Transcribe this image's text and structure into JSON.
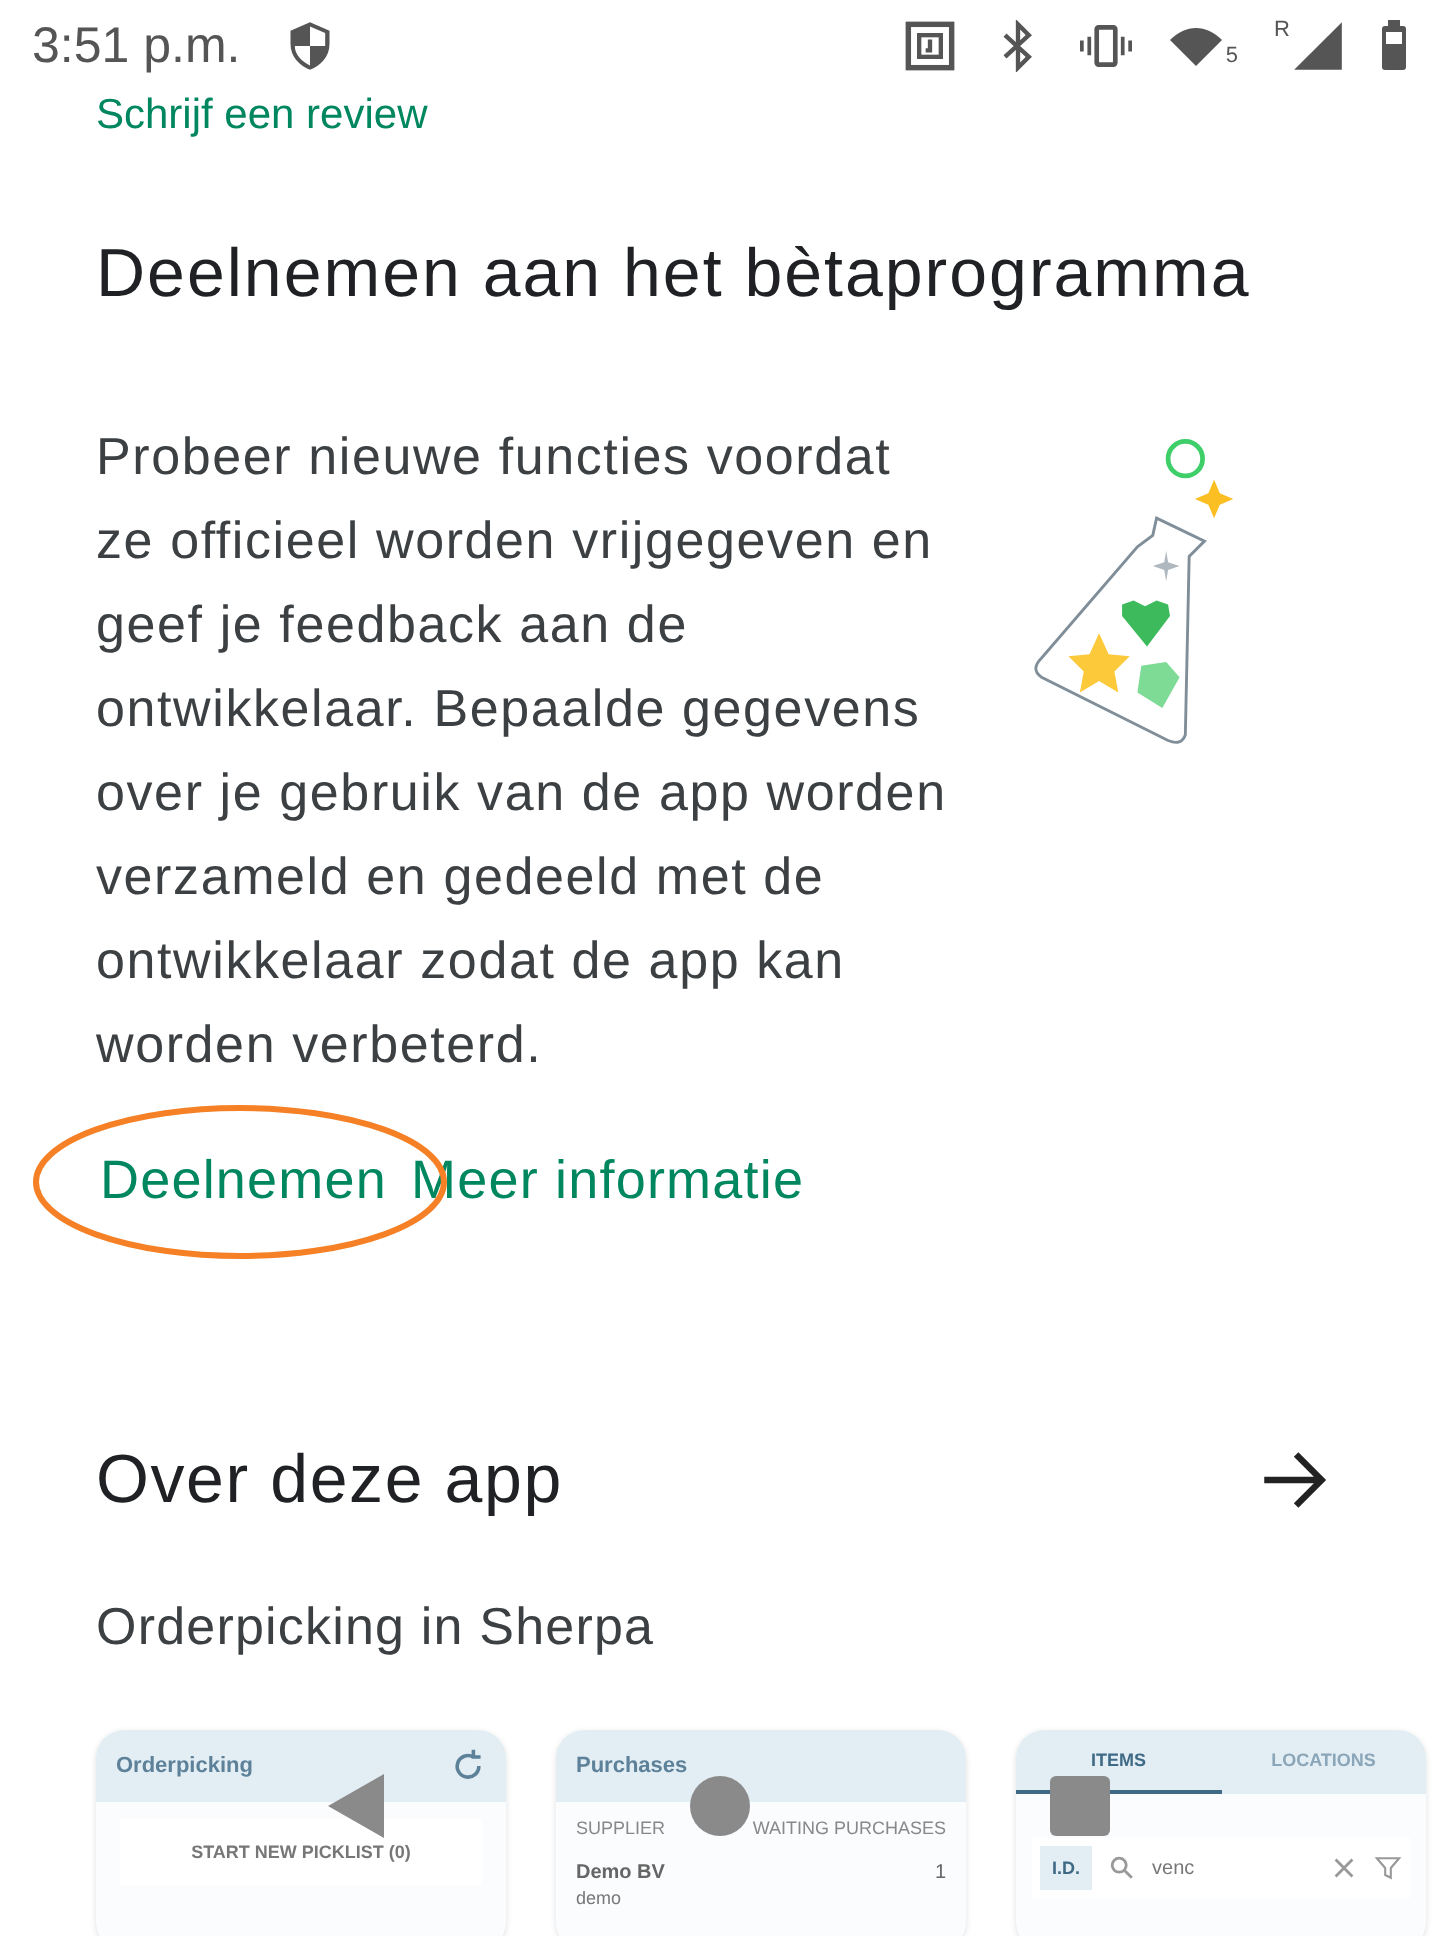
{
  "status_bar": {
    "time": "3:51 p.m.",
    "wifi_badge": "5",
    "network_badge": "R"
  },
  "review_link": "Schrijf een review",
  "beta": {
    "title": "Deelnemen aan het bètaprogramma",
    "text": "Probeer nieuwe functies voordat ze officieel worden vrijgegeven en geef je feedback aan de ontwikkelaar. Bepaalde gegevens over je gebruik van de app worden verzameld en gedeeld met de ontwikkelaar zodat de app kan worden verbeterd.",
    "links": [
      {
        "label": "Deelnemen",
        "circled": true
      },
      {
        "label": "Meer informatie",
        "circled": false
      }
    ]
  },
  "about": {
    "title": "Over deze app",
    "subtitle": "Orderpicking in Sherpa"
  },
  "screenshots": [
    {
      "kind": "picklist",
      "title": "Orderpicking",
      "button": "START NEW PICKLIST (0)"
    },
    {
      "kind": "purchases",
      "title": "Purchases",
      "columns": [
        "SUPPLIER",
        "WAITING PURCHASES"
      ],
      "row_name": "Demo BV",
      "row_sub": "demo",
      "row_count": "1"
    },
    {
      "kind": "items",
      "tabs": [
        {
          "label": "ITEMS",
          "selected": true
        },
        {
          "label": "LOCATIONS",
          "selected": false
        }
      ],
      "chip": "I.D.",
      "search": "venc"
    }
  ]
}
